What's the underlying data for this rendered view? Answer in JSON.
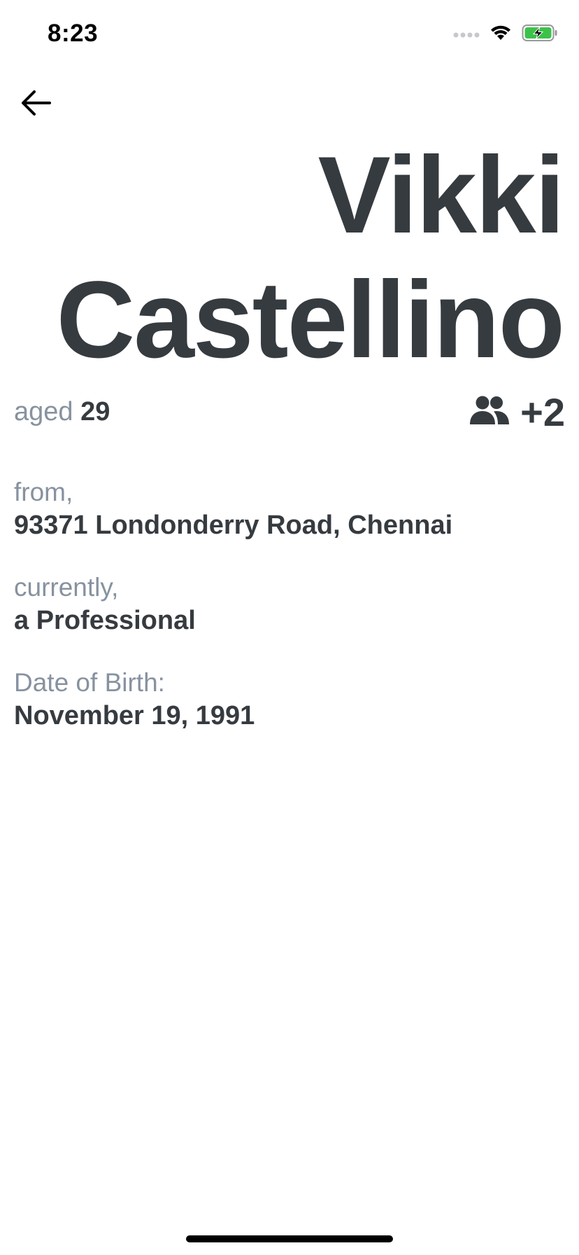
{
  "status_bar": {
    "time": "8:23"
  },
  "profile": {
    "first_name": "Vikki",
    "last_name": "Castellino",
    "age_label": "aged",
    "age_value": "29",
    "family_count": "+2"
  },
  "fields": {
    "from_label": "from,",
    "from_value": "93371 Londonderry Road, Chennai",
    "currently_label": "currently,",
    "currently_value": "a Professional",
    "dob_label": "Date of Birth:",
    "dob_value": "November 19, 1991"
  },
  "icons": {
    "back": "arrow-left-icon",
    "family": "users-icon"
  },
  "colors": {
    "primary_text": "#363b40",
    "secondary_text": "#8792a0",
    "battery_green": "#3cc24a"
  }
}
